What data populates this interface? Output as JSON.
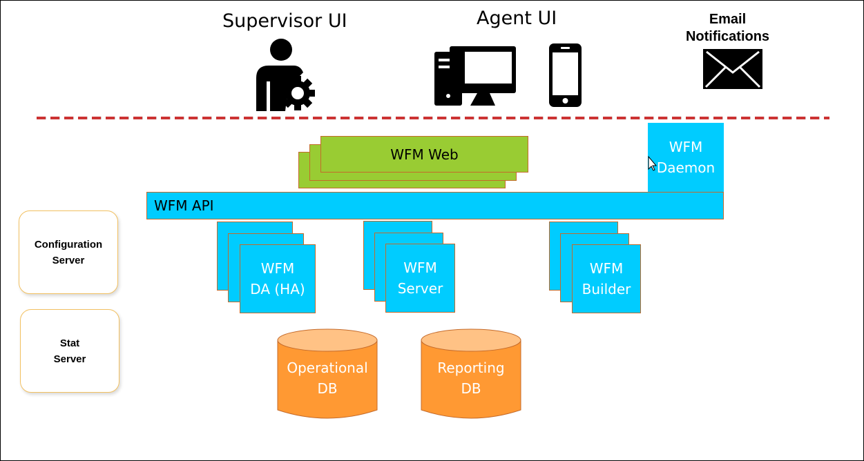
{
  "top": {
    "supervisor_ui": "Supervisor UI",
    "agent_ui": "Agent UI",
    "email_line1": "Email",
    "email_line2": "Notifications"
  },
  "components": {
    "wfm_web": "WFM Web",
    "wfm_daemon_line1": "WFM",
    "wfm_daemon_line2": "Daemon",
    "wfm_api": "WFM API",
    "da_line1": "WFM",
    "da_line2": "DA (HA)",
    "server_line1": "WFM",
    "server_line2": "Server",
    "builder_line1": "WFM",
    "builder_line2": "Builder"
  },
  "databases": {
    "operational_line1": "Operational",
    "operational_line2": "DB",
    "reporting_line1": "Reporting",
    "reporting_line2": "DB"
  },
  "external": {
    "config_line1": "Configuration",
    "config_line2": "Server",
    "stat_line1": "Stat",
    "stat_line2": "Server"
  },
  "colors": {
    "component": "#00ccff",
    "web": "#99cc33",
    "database": "#ff9933",
    "divider": "#cc3333"
  }
}
